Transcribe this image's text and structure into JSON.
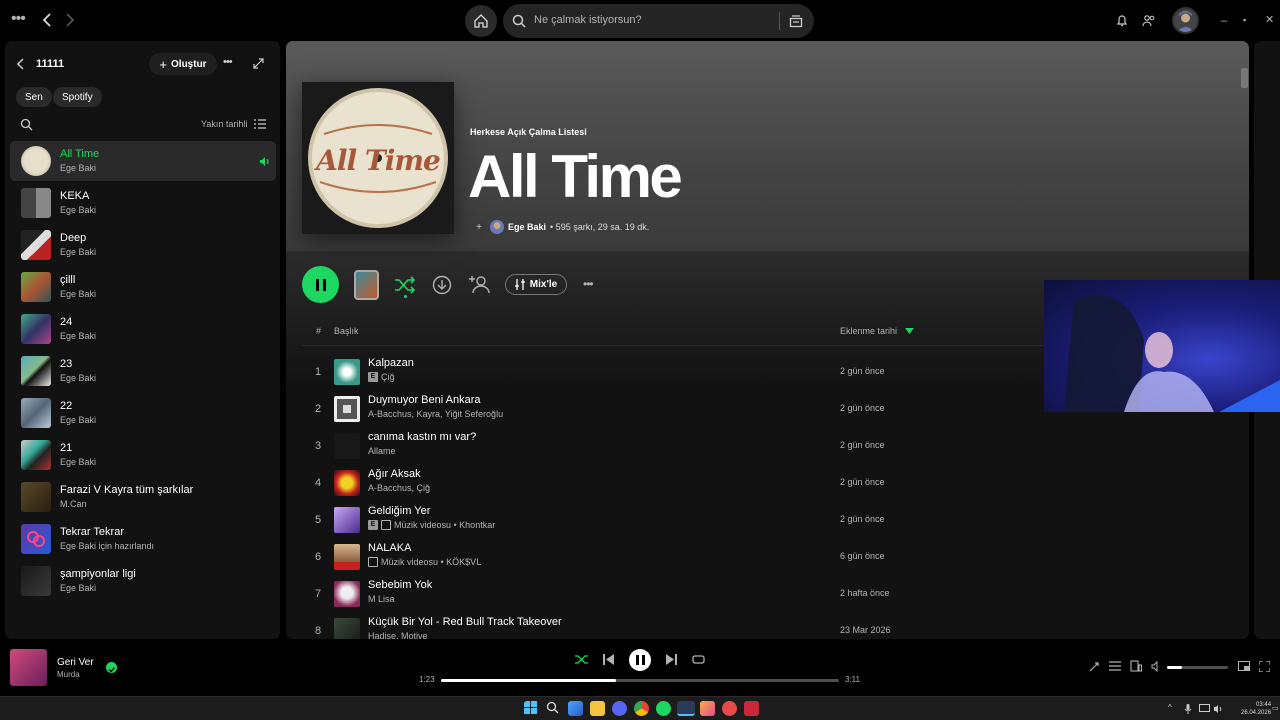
{
  "topbar": {
    "search_placeholder": "Ne çalmak istiyorsun?"
  },
  "sidebar": {
    "title": "11111",
    "create_label": "Oluştur",
    "filters": [
      "Sen",
      "Spotify"
    ],
    "sort_label": "Yakın tarihli",
    "items": [
      {
        "name": "All Time",
        "sub": "Ege Baki"
      },
      {
        "name": "KEKA",
        "sub": "Ege Baki"
      },
      {
        "name": "Deep",
        "sub": "Ege Baki"
      },
      {
        "name": "çilll",
        "sub": "Ege Baki"
      },
      {
        "name": "24",
        "sub": "Ege Baki"
      },
      {
        "name": "23",
        "sub": "Ege Baki"
      },
      {
        "name": "22",
        "sub": "Ege Baki"
      },
      {
        "name": "21",
        "sub": "Ege Baki"
      },
      {
        "name": "Farazi V Kayra tüm şarkılar",
        "sub": "M.Can"
      },
      {
        "name": "Tekrar Tekrar",
        "sub": "Ege Baki için hazırlandı"
      },
      {
        "name": "şampiyonlar ligi",
        "sub": "Ege Baki"
      }
    ]
  },
  "playlist": {
    "type_label": "Herkese Açık Çalma Listesi",
    "title": "All Time",
    "cover_text": "All Time",
    "owner": "Ege Baki",
    "stats": "• 595 şarkı, 29 sa. 19 dk.",
    "mix_label": "Mix'le"
  },
  "table": {
    "col_num": "#",
    "col_title": "Başlık",
    "col_date": "Eklenme tarihi",
    "tracks": [
      {
        "num": "1",
        "title": "Kalpazan",
        "explicit": true,
        "video": false,
        "artists": "Çiğ",
        "date": "2 gün önce"
      },
      {
        "num": "2",
        "title": "Duymuyor Beni Ankara",
        "explicit": false,
        "video": false,
        "artists": "A-Bacchus, Kayra, Yiğit Seferoğlu",
        "date": "2 gün önce"
      },
      {
        "num": "3",
        "title": "canıma kastın mı var?",
        "explicit": false,
        "video": false,
        "artists": "Allame",
        "date": "2 gün önce"
      },
      {
        "num": "4",
        "title": "Ağır Aksak",
        "explicit": false,
        "video": false,
        "artists": "A-Bacchus, Çiğ",
        "date": "2 gün önce"
      },
      {
        "num": "5",
        "title": "Geldiğim Yer",
        "explicit": true,
        "video": true,
        "artists": "Müzik videosu • Khontkar",
        "date": "2 gün önce"
      },
      {
        "num": "6",
        "title": "NALAKA",
        "explicit": false,
        "video": true,
        "artists": "Müzik videosu • KÖK$VL",
        "date": "6 gün önce"
      },
      {
        "num": "7",
        "title": "Sebebim Yok",
        "explicit": false,
        "video": false,
        "artists": "M Lisa",
        "date": "2 hafta önce"
      },
      {
        "num": "8",
        "title": "Küçük Bir Yol - Red Bull Track Takeover",
        "explicit": false,
        "video": false,
        "artists": "Hadise, Motive",
        "date": "23 Mar 2026"
      }
    ]
  },
  "player": {
    "title": "Geri Ver",
    "artist": "Murda",
    "elapsed": "1:23",
    "duration": "3:11",
    "progress": 0.44,
    "volume": 0.25
  },
  "taskbar": {
    "time": "03:44",
    "date": "26.04.2026"
  },
  "colors": {
    "accent": "#1ed760",
    "background": "#121212",
    "surface": "#2a2a2a"
  }
}
